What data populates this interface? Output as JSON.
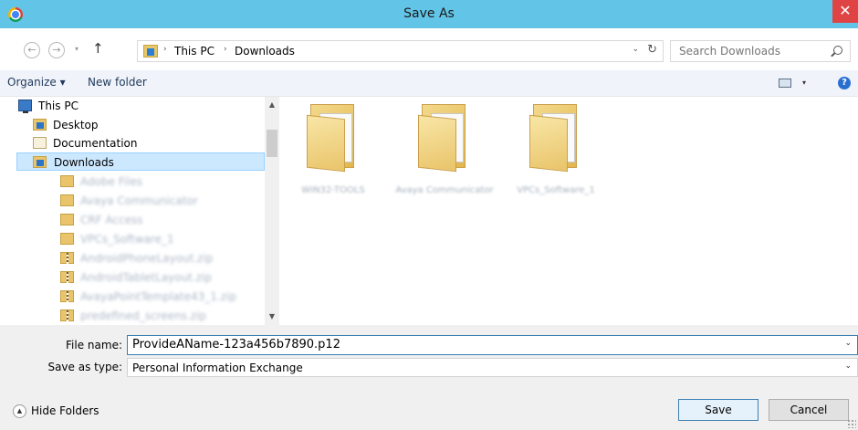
{
  "window": {
    "title": "Save As",
    "close_glyph": "✕",
    "accent": "#62c5e7",
    "close_color": "#e04343"
  },
  "nav": {
    "back_glyph": "←",
    "forward_glyph": "→",
    "up_glyph": "↑",
    "recent_glyph": "▾"
  },
  "address": {
    "breadcrumbs": [
      "This PC",
      "Downloads"
    ],
    "separator": "›",
    "dropdown_glyph": "⌄",
    "refresh_glyph": "↻"
  },
  "search": {
    "placeholder": "Search Downloads"
  },
  "toolbar": {
    "organize_label": "Organize ▾",
    "new_folder_label": "New folder",
    "view_dd_glyph": "▾",
    "help_glyph": "?"
  },
  "tree": {
    "items": [
      {
        "label": "This PC",
        "icon": "computer-icon"
      },
      {
        "label": "Desktop",
        "icon": "folder-icon"
      },
      {
        "label": "Documentation",
        "icon": "document-icon"
      },
      {
        "label": "Downloads",
        "icon": "downloads-folder-icon",
        "selected": true
      },
      {
        "label": "Adobe Files",
        "icon": "folder-icon"
      },
      {
        "label": "Avaya Communicator",
        "icon": "folder-icon"
      },
      {
        "label": "CRF Access",
        "icon": "folder-icon"
      },
      {
        "label": "VPCs_Software_1",
        "icon": "folder-icon"
      },
      {
        "label": "AndroidPhoneLayout.zip",
        "icon": "zip-icon"
      },
      {
        "label": "AndroidTabletLayout.zip",
        "icon": "zip-icon"
      },
      {
        "label": "AvayaPointTemplate43_1.zip",
        "icon": "zip-icon"
      },
      {
        "label": "predefined_screens.zip",
        "icon": "zip-icon"
      }
    ],
    "scroll_up_glyph": "▲",
    "scroll_down_glyph": "▼"
  },
  "files": [
    {
      "name": "WIN32-TOOLS",
      "icon": "folder-icon"
    },
    {
      "name": "Avaya Communicator",
      "icon": "folder-icon"
    },
    {
      "name": "VPCs_Software_1",
      "icon": "folder-icon"
    }
  ],
  "form": {
    "filename_label": "File name:",
    "filename_value": "ProvideAName-123a456b7890.p12",
    "savetype_label": "Save as type:",
    "savetype_value": "Personal Information Exchange",
    "dd_glyph": "⌄"
  },
  "footer": {
    "hide_folders_label": "Hide Folders",
    "hide_folders_glyph": "▲",
    "save_label": "Save",
    "cancel_label": "Cancel"
  }
}
